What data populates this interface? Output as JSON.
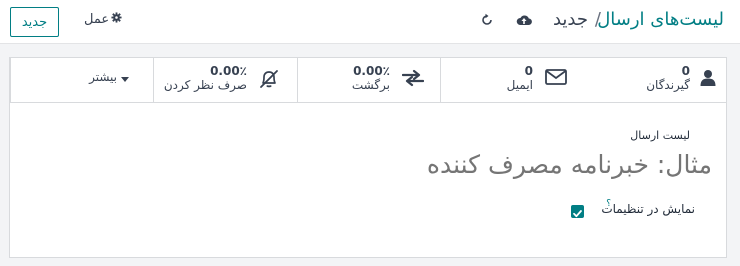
{
  "header": {
    "breadcrumb_root": "لیست‌های ارسال",
    "breadcrumb_sep": "/",
    "breadcrumb_current": "جدید",
    "action_label": "عمل",
    "new_button": "جدید"
  },
  "stats": {
    "recipients": {
      "value": "0",
      "label": "گیرندگان"
    },
    "email": {
      "value": "0",
      "label": "ایمیل"
    },
    "bounce": {
      "value": "0.00٪",
      "label": "برگشت"
    },
    "optout": {
      "value": "0.00٪",
      "label": "صرف نظر کردن"
    },
    "more": "بیشتر"
  },
  "form": {
    "name_label": "لیست ارسال",
    "name_placeholder": "مثال: خبرنامه مصرف کننده",
    "show_in_prefs_label": "نمایش در تنظیمات",
    "show_in_prefs_help": "؟",
    "show_in_prefs_checked": true
  },
  "colors": {
    "accent": "#017e84"
  }
}
